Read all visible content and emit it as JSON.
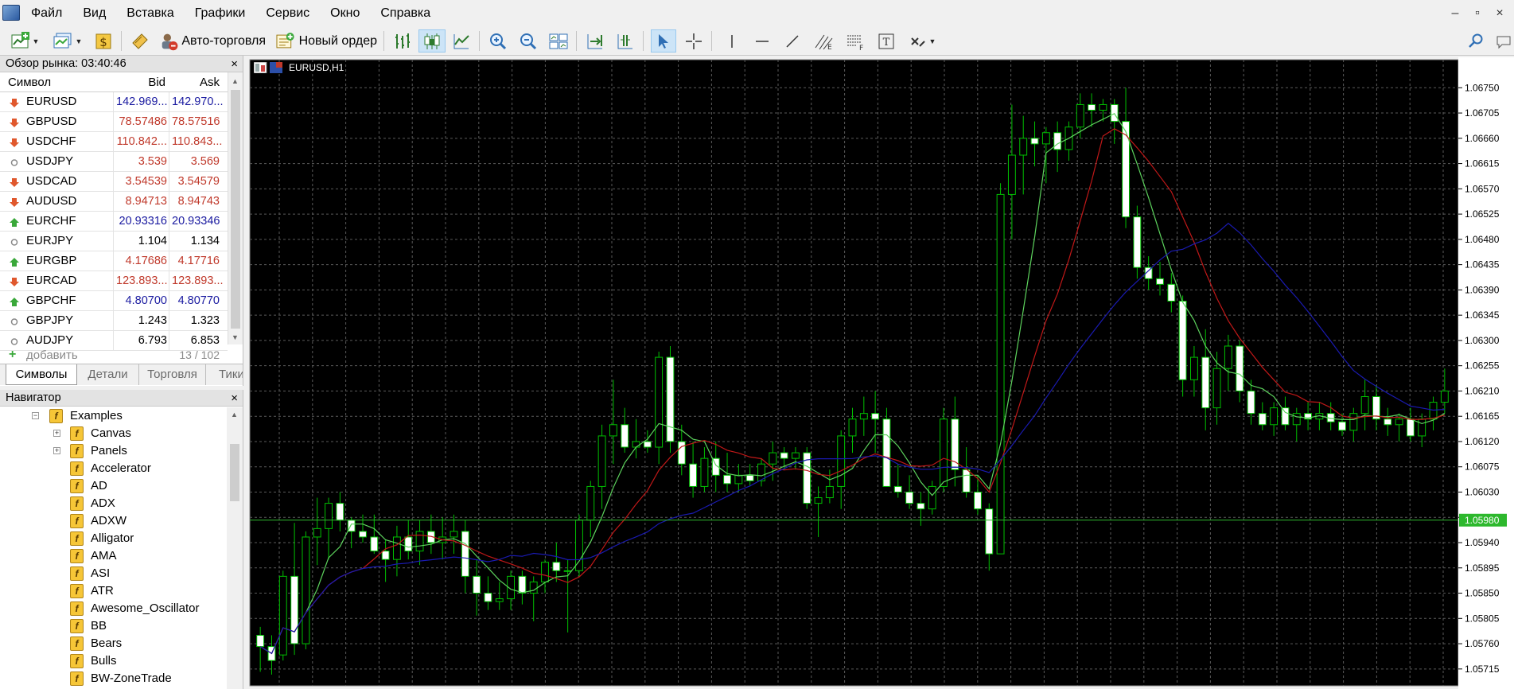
{
  "menu": [
    "Файл",
    "Вид",
    "Вставка",
    "Графики",
    "Сервис",
    "Окно",
    "Справка"
  ],
  "window_controls": [
    "–",
    "▫",
    "×"
  ],
  "toolbar": {
    "auto_trading_label": "Авто-торговля",
    "new_order_label": "Новый ордер"
  },
  "market_watch": {
    "title": "Обзор рынка: 03:40:46",
    "close": "×",
    "headers": {
      "symbol": "Символ",
      "bid": "Bid",
      "ask": "Ask"
    },
    "rows": [
      {
        "symbol": "EURUSD",
        "bid": "142.969...",
        "ask": "142.970...",
        "color": "blue",
        "dir": "down"
      },
      {
        "symbol": "GBPUSD",
        "bid": "78.57486",
        "ask": "78.57516",
        "color": "red",
        "dir": "down"
      },
      {
        "symbol": "USDCHF",
        "bid": "110.842...",
        "ask": "110.843...",
        "color": "red",
        "dir": "down"
      },
      {
        "symbol": "USDJPY",
        "bid": "3.539",
        "ask": "3.569",
        "color": "red",
        "dir": "flat"
      },
      {
        "symbol": "USDCAD",
        "bid": "3.54539",
        "ask": "3.54579",
        "color": "red",
        "dir": "down"
      },
      {
        "symbol": "AUDUSD",
        "bid": "8.94713",
        "ask": "8.94743",
        "color": "red",
        "dir": "down"
      },
      {
        "symbol": "EURCHF",
        "bid": "20.93316",
        "ask": "20.93346",
        "color": "blue",
        "dir": "up"
      },
      {
        "symbol": "EURJPY",
        "bid": "1.104",
        "ask": "1.134",
        "color": "black",
        "dir": "flat"
      },
      {
        "symbol": "EURGBP",
        "bid": "4.17686",
        "ask": "4.17716",
        "color": "red",
        "dir": "up"
      },
      {
        "symbol": "EURCAD",
        "bid": "123.893...",
        "ask": "123.893...",
        "color": "red",
        "dir": "down"
      },
      {
        "symbol": "GBPCHF",
        "bid": "4.80700",
        "ask": "4.80770",
        "color": "blue",
        "dir": "up"
      },
      {
        "symbol": "GBPJPY",
        "bid": "1.243",
        "ask": "1.323",
        "color": "black",
        "dir": "flat"
      },
      {
        "symbol": "AUDJPY",
        "bid": "6.793",
        "ask": "6.853",
        "color": "black",
        "dir": "flat"
      }
    ],
    "add_label": "добавить",
    "count": "13 / 102",
    "tabs": [
      "Символы",
      "Детали",
      "Торговля",
      "Тики"
    ]
  },
  "navigator": {
    "title": "Навигатор",
    "close": "×",
    "items": [
      {
        "label": "Examples",
        "level": 0,
        "expand": "−"
      },
      {
        "label": "Canvas",
        "level": 1,
        "expand": "+"
      },
      {
        "label": "Panels",
        "level": 1,
        "expand": "+"
      },
      {
        "label": "Accelerator",
        "level": 1
      },
      {
        "label": "AD",
        "level": 1
      },
      {
        "label": "ADX",
        "level": 1
      },
      {
        "label": "ADXW",
        "level": 1
      },
      {
        "label": "Alligator",
        "level": 1
      },
      {
        "label": "AMA",
        "level": 1
      },
      {
        "label": "ASI",
        "level": 1
      },
      {
        "label": "ATR",
        "level": 1
      },
      {
        "label": "Awesome_Oscillator",
        "level": 1
      },
      {
        "label": "BB",
        "level": 1
      },
      {
        "label": "Bears",
        "level": 1
      },
      {
        "label": "Bulls",
        "level": 1
      },
      {
        "label": "BW-ZoneTrade",
        "level": 1
      }
    ]
  },
  "chart": {
    "title": "EURUSD,H1",
    "colors": {
      "background": "#000000",
      "grid": "#5a5a5a",
      "bull_candle": "#000000",
      "bear_candle": "#ffffff",
      "wick": "#00c000",
      "ma_fast": "#5dd35d",
      "ma_mid": "#c01818",
      "ma_slow": "#1a1ab0",
      "bid_line": "#2db82d"
    }
  },
  "chart_data": {
    "type": "candlestick",
    "symbol": "EURUSD",
    "timeframe": "H1",
    "y_ticks": [
      "1.06750",
      "1.06705",
      "1.06660",
      "1.06615",
      "1.06570",
      "1.06525",
      "1.06480",
      "1.06435",
      "1.06390",
      "1.06345",
      "1.06300",
      "1.06255",
      "1.06210",
      "1.06165",
      "1.06120",
      "1.06075",
      "1.06030",
      "1.05985",
      "1.05940",
      "1.05895",
      "1.05850",
      "1.05805",
      "1.05760",
      "1.05715"
    ],
    "ylim": [
      1.05685,
      1.068
    ],
    "current_price": "1.05980",
    "candles": [
      [
        1.05775,
        1.0579,
        1.0571,
        1.05755
      ],
      [
        1.05755,
        1.05775,
        1.05705,
        1.0573
      ],
      [
        1.0574,
        1.0589,
        1.0573,
        1.0588
      ],
      [
        1.0588,
        1.05975,
        1.0574,
        1.0576
      ],
      [
        1.0576,
        1.0596,
        1.0575,
        1.0595
      ],
      [
        1.0595,
        1.0602,
        1.059,
        1.05965
      ],
      [
        1.05965,
        1.0602,
        1.0591,
        1.0601
      ],
      [
        1.0601,
        1.0603,
        1.0596,
        1.0598
      ],
      [
        1.0598,
        1.05985,
        1.0593,
        1.0596
      ],
      [
        1.0596,
        1.0599,
        1.0594,
        1.0595
      ],
      [
        1.0595,
        1.0599,
        1.0592,
        1.05925
      ],
      [
        1.05925,
        1.05945,
        1.0587,
        1.0591
      ],
      [
        1.0591,
        1.0597,
        1.0588,
        1.0595
      ],
      [
        1.0595,
        1.0598,
        1.0591,
        1.05925
      ],
      [
        1.05925,
        1.0598,
        1.059,
        1.0596
      ],
      [
        1.0596,
        1.0599,
        1.0592,
        1.0594
      ],
      [
        1.0594,
        1.05985,
        1.0591,
        1.0595
      ],
      [
        1.0595,
        1.0599,
        1.0592,
        1.0596
      ],
      [
        1.0596,
        1.0598,
        1.0585,
        1.0588
      ],
      [
        1.0588,
        1.0591,
        1.0581,
        1.0585
      ],
      [
        1.0585,
        1.0588,
        1.0582,
        1.05835
      ],
      [
        1.05835,
        1.0587,
        1.0582,
        1.0584
      ],
      [
        1.0584,
        1.0589,
        1.0582,
        1.0588
      ],
      [
        1.0588,
        1.0589,
        1.0583,
        1.0585
      ],
      [
        1.0585,
        1.0588,
        1.058,
        1.0587
      ],
      [
        1.0587,
        1.0591,
        1.0585,
        1.05905
      ],
      [
        1.05905,
        1.0594,
        1.0587,
        1.0589
      ],
      [
        1.0589,
        1.0591,
        1.0578,
        1.0589
      ],
      [
        1.0589,
        1.0599,
        1.0588,
        1.0598
      ],
      [
        1.0598,
        1.0605,
        1.0595,
        1.0604
      ],
      [
        1.0604,
        1.0615,
        1.06,
        1.0613
      ],
      [
        1.0613,
        1.0623,
        1.0608,
        1.0615
      ],
      [
        1.0615,
        1.0618,
        1.061,
        1.0611
      ],
      [
        1.0611,
        1.0616,
        1.0609,
        1.0612
      ],
      [
        1.0612,
        1.0614,
        1.061,
        1.0611
      ],
      [
        1.0611,
        1.0628,
        1.0608,
        1.0627
      ],
      [
        1.0627,
        1.0629,
        1.061,
        1.0612
      ],
      [
        1.0612,
        1.0615,
        1.0606,
        1.0608
      ],
      [
        1.0608,
        1.0612,
        1.0602,
        1.0604
      ],
      [
        1.0604,
        1.0611,
        1.0603,
        1.0609
      ],
      [
        1.0609,
        1.0612,
        1.0603,
        1.0606
      ],
      [
        1.0606,
        1.061,
        1.0603,
        1.06045
      ],
      [
        1.06045,
        1.0608,
        1.0603,
        1.0606
      ],
      [
        1.0606,
        1.0608,
        1.0604,
        1.0605
      ],
      [
        1.0605,
        1.0609,
        1.0604,
        1.0608
      ],
      [
        1.0608,
        1.0612,
        1.0605,
        1.061
      ],
      [
        1.061,
        1.0611,
        1.0607,
        1.0609
      ],
      [
        1.0609,
        1.0611,
        1.0607,
        1.061
      ],
      [
        1.061,
        1.0611,
        1.06,
        1.0601
      ],
      [
        1.0601,
        1.0604,
        1.0595,
        1.0602
      ],
      [
        1.0602,
        1.0607,
        1.0601,
        1.0604
      ],
      [
        1.0604,
        1.0614,
        1.06,
        1.0613
      ],
      [
        1.0613,
        1.0618,
        1.061,
        1.0616
      ],
      [
        1.0616,
        1.062,
        1.0613,
        1.0617
      ],
      [
        1.0617,
        1.0621,
        1.061,
        1.0616
      ],
      [
        1.0616,
        1.0618,
        1.0604,
        1.0604
      ],
      [
        1.0604,
        1.0608,
        1.0602,
        1.0603
      ],
      [
        1.0603,
        1.0606,
        1.06,
        1.0601
      ],
      [
        1.0601,
        1.0603,
        1.0597,
        1.06
      ],
      [
        1.06,
        1.0605,
        1.0599,
        1.0604
      ],
      [
        1.0604,
        1.0618,
        1.0603,
        1.0616
      ],
      [
        1.0616,
        1.062,
        1.0604,
        1.0607
      ],
      [
        1.0607,
        1.0611,
        1.0602,
        1.0603
      ],
      [
        1.0603,
        1.0606,
        1.0599,
        1.06
      ],
      [
        1.06,
        1.0601,
        1.0589,
        1.0592
      ],
      [
        1.0592,
        1.0658,
        1.0592,
        1.0656
      ],
      [
        1.0656,
        1.0672,
        1.0648,
        1.0663
      ],
      [
        1.0663,
        1.067,
        1.0656,
        1.0666
      ],
      [
        1.0666,
        1.0669,
        1.0661,
        1.0665
      ],
      [
        1.0665,
        1.0668,
        1.0658,
        1.0667
      ],
      [
        1.0667,
        1.0669,
        1.066,
        1.0664
      ],
      [
        1.0664,
        1.0669,
        1.0662,
        1.0668
      ],
      [
        1.0668,
        1.0674,
        1.0666,
        1.0672
      ],
      [
        1.0672,
        1.0674,
        1.0668,
        1.0671
      ],
      [
        1.0671,
        1.0673,
        1.0669,
        1.0672
      ],
      [
        1.0672,
        1.0673,
        1.0665,
        1.0669
      ],
      [
        1.0669,
        1.0675,
        1.065,
        1.0652
      ],
      [
        1.0652,
        1.0654,
        1.0641,
        1.0643
      ],
      [
        1.0643,
        1.0645,
        1.0639,
        1.0641
      ],
      [
        1.0641,
        1.0644,
        1.0638,
        1.064
      ],
      [
        1.064,
        1.0642,
        1.0635,
        1.0637
      ],
      [
        1.0637,
        1.0638,
        1.062,
        1.0623
      ],
      [
        1.0623,
        1.0629,
        1.062,
        1.0627
      ],
      [
        1.0627,
        1.0632,
        1.0614,
        1.0618
      ],
      [
        1.0618,
        1.0628,
        1.0615,
        1.0625
      ],
      [
        1.0625,
        1.0631,
        1.0621,
        1.0629
      ],
      [
        1.0629,
        1.063,
        1.0619,
        1.0621
      ],
      [
        1.0621,
        1.0623,
        1.0615,
        1.0617
      ],
      [
        1.0617,
        1.0619,
        1.0614,
        1.0615
      ],
      [
        1.0615,
        1.0619,
        1.0613,
        1.0618
      ],
      [
        1.0618,
        1.062,
        1.0614,
        1.0615
      ],
      [
        1.0615,
        1.0618,
        1.0612,
        1.0617
      ],
      [
        1.0617,
        1.0619,
        1.0614,
        1.0616
      ],
      [
        1.0616,
        1.0619,
        1.0614,
        1.0617
      ],
      [
        1.0617,
        1.0619,
        1.0614,
        1.06155
      ],
      [
        1.06155,
        1.0617,
        1.0613,
        1.0614
      ],
      [
        1.0614,
        1.0618,
        1.0612,
        1.0617
      ],
      [
        1.0617,
        1.0623,
        1.0614,
        1.062
      ],
      [
        1.062,
        1.0622,
        1.0614,
        1.0616
      ],
      [
        1.0616,
        1.0618,
        1.0613,
        1.0615
      ],
      [
        1.0615,
        1.0617,
        1.0612,
        1.0616
      ],
      [
        1.0616,
        1.0618,
        1.0612,
        1.0613
      ],
      [
        1.0613,
        1.0617,
        1.0611,
        1.0616
      ],
      [
        1.0616,
        1.062,
        1.0614,
        1.0619
      ],
      [
        1.0619,
        1.0625,
        1.0617,
        1.0621
      ]
    ]
  }
}
